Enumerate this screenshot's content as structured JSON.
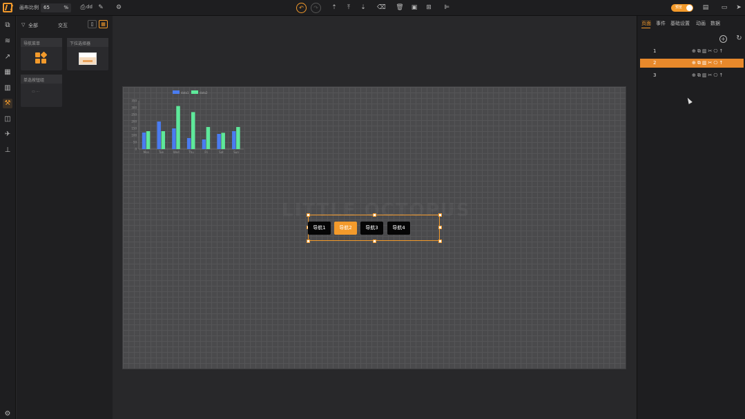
{
  "toolbar": {
    "scale_label": "画布比例",
    "scale_value": "65",
    "scale_unit": "%",
    "project_name": "dd",
    "toggle_label": "预览"
  },
  "left_nav": {
    "items": [
      "component-icon",
      "layers-icon",
      "chart-icon",
      "media-icon",
      "table-icon",
      "interaction-icon",
      "shapes-icon",
      "plane-icon",
      "stamp-icon"
    ],
    "bottom": "settings-icon"
  },
  "component_panel": {
    "tabs": [
      "全部",
      "交互"
    ],
    "cards": [
      {
        "title": "导航菜单"
      },
      {
        "title": "下拉选择器"
      },
      {
        "title": "单选按钮组"
      }
    ]
  },
  "canvas": {
    "watermark": "LITTLE OCTOPUS",
    "nav_buttons": [
      "导航1",
      "导航2",
      "导航3",
      "导航4"
    ],
    "active_nav_index": 1
  },
  "chart_data": {
    "type": "bar",
    "categories": [
      "Mon",
      "Tue",
      "Wed",
      "Thu",
      "Fri",
      "Sat",
      "Sun"
    ],
    "series": [
      {
        "name": "data1",
        "color": "#4a7cf0",
        "values": [
          120,
          200,
          150,
          80,
          70,
          110,
          130
        ]
      },
      {
        "name": "data2",
        "color": "#5ee89a",
        "values": [
          130,
          130,
          312,
          268,
          160,
          118,
          160
        ]
      }
    ],
    "yticks": [
      0,
      50,
      100,
      150,
      200,
      250,
      300,
      350
    ],
    "ylim": [
      0,
      350
    ],
    "legend": "top"
  },
  "right_panel": {
    "tabs": [
      "页面",
      "事件",
      "基础设置",
      "动画",
      "数据"
    ],
    "active_tab": 0,
    "pages": [
      {
        "label": "1",
        "active": false
      },
      {
        "label": "2",
        "active": true
      },
      {
        "label": "3",
        "active": false
      }
    ],
    "row_icons": "⊕⧉▥✂⎔↑"
  }
}
